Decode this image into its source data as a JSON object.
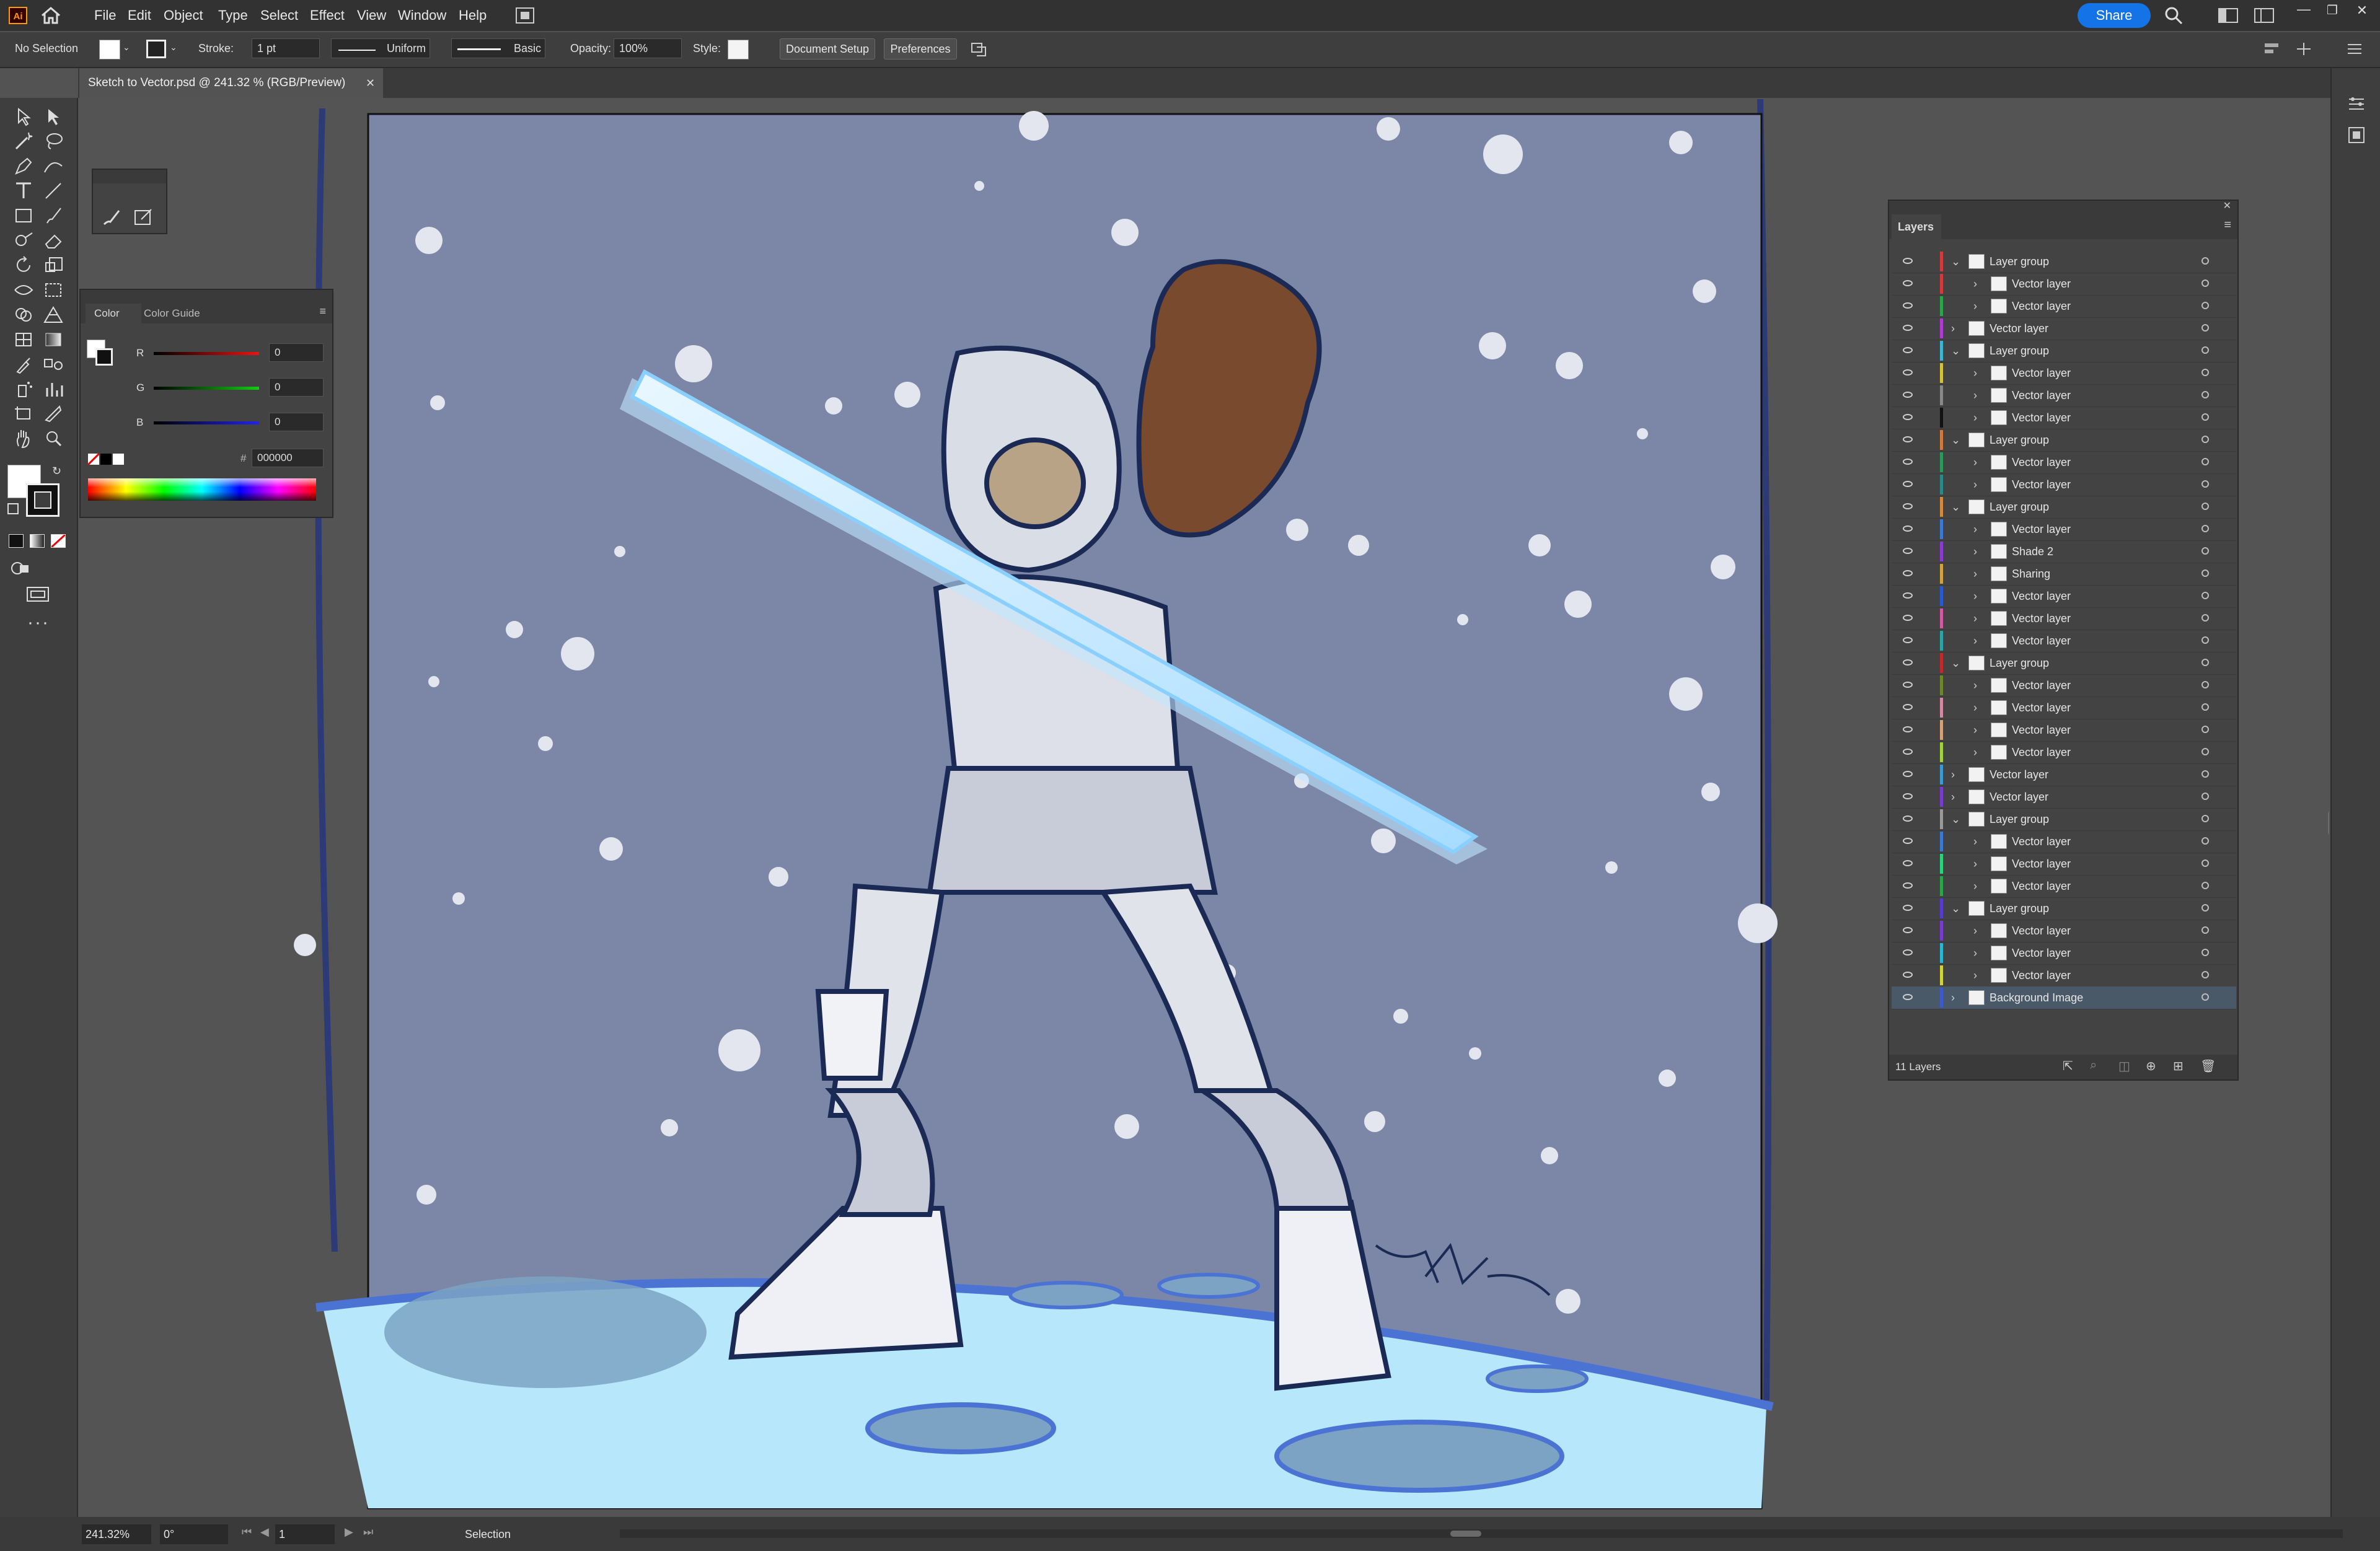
{
  "menubar": {
    "logo": "Ai",
    "items": [
      "File",
      "Edit",
      "Object",
      "Type",
      "Select",
      "Effect",
      "View",
      "Window",
      "Help"
    ],
    "share_label": "Share"
  },
  "controlbar": {
    "selection": "No Selection",
    "stroke_label": "Stroke:",
    "stroke_value": "1 pt",
    "profile": "Uniform",
    "brush": "Basic",
    "opacity_label": "Opacity:",
    "opacity_value": "100%",
    "style_label": "Style:",
    "doc_setup": "Document Setup",
    "preferences": "Preferences"
  },
  "document": {
    "tab_title": "Sketch to Vector.psd @ 241.32 % (RGB/Preview)"
  },
  "color_panel": {
    "tabs": [
      "Color",
      "Color Guide"
    ],
    "channels": [
      {
        "label": "R",
        "value": "0",
        "color": "#d22"
      },
      {
        "label": "G",
        "value": "0",
        "color": "#2a2"
      },
      {
        "label": "B",
        "value": "0",
        "color": "#22d"
      }
    ],
    "hex_label": "#",
    "hex_value": "000000"
  },
  "layers_panel": {
    "title": "Layers",
    "footer_count": "11 Layers",
    "rows": [
      {
        "name": "Layer group",
        "level": 0,
        "expanded": true,
        "color": "#d23b3b"
      },
      {
        "name": "Vector layer",
        "level": 1,
        "color": "#d23b3b"
      },
      {
        "name": "Vector layer",
        "level": 1,
        "color": "#2aa54a"
      },
      {
        "name": "Vector layer",
        "level": 0,
        "color": "#b03bd2"
      },
      {
        "name": "Layer group",
        "level": 0,
        "expanded": true,
        "color": "#3bb7d2"
      },
      {
        "name": "Vector layer",
        "level": 1,
        "color": "#d2c23b"
      },
      {
        "name": "Vector layer",
        "level": 1,
        "color": "#888888"
      },
      {
        "name": "Vector layer",
        "level": 1,
        "color": "#111111"
      },
      {
        "name": "Layer group",
        "level": 0,
        "expanded": true,
        "color": "#d27a3b"
      },
      {
        "name": "Vector layer",
        "level": 1,
        "color": "#2a9a5a"
      },
      {
        "name": "Vector layer",
        "level": 1,
        "color": "#2a8a8a"
      },
      {
        "name": "Layer group",
        "level": 0,
        "expanded": true,
        "color": "#d28a3b"
      },
      {
        "name": "Vector layer",
        "level": 1,
        "color": "#3b7ad2"
      },
      {
        "name": "Shade 2",
        "level": 1,
        "color": "#8a3bd2"
      },
      {
        "name": "Sharing",
        "level": 1,
        "color": "#d2a23b"
      },
      {
        "name": "Vector layer",
        "level": 1,
        "color": "#2a5ad2"
      },
      {
        "name": "Vector layer",
        "level": 1,
        "color": "#d25aa2"
      },
      {
        "name": "Vector layer",
        "level": 1,
        "color": "#2aa5a5"
      },
      {
        "name": "Layer group",
        "level": 0,
        "expanded": true,
        "color": "#c22a2a"
      },
      {
        "name": "Vector layer",
        "level": 1,
        "color": "#6a8a2a"
      },
      {
        "name": "Vector layer",
        "level": 1,
        "color": "#d28aa2"
      },
      {
        "name": "Vector layer",
        "level": 1,
        "color": "#d2a27a"
      },
      {
        "name": "Vector layer",
        "level": 1,
        "color": "#a2d23b"
      },
      {
        "name": "Vector layer",
        "level": 0,
        "color": "#3b9ad2"
      },
      {
        "name": "Vector layer",
        "level": 0,
        "color": "#7a3bd2"
      },
      {
        "name": "Layer group",
        "level": 0,
        "expanded": true,
        "color": "#9a9a9a"
      },
      {
        "name": "Vector layer",
        "level": 1,
        "color": "#3b7ad2"
      },
      {
        "name": "Vector layer",
        "level": 1,
        "color": "#2ad27a"
      },
      {
        "name": "Vector layer",
        "level": 1,
        "color": "#2aa54a"
      },
      {
        "name": "Layer group",
        "level": 0,
        "expanded": true,
        "color": "#5a3bd2"
      },
      {
        "name": "Vector layer",
        "level": 1,
        "color": "#7a3bd2"
      },
      {
        "name": "Vector layer",
        "level": 1,
        "color": "#2ab7d2"
      },
      {
        "name": "Vector layer",
        "level": 1,
        "color": "#d2d23b"
      },
      {
        "name": "Background Image",
        "level": 0,
        "selected": true,
        "color": "#3b5ad2"
      }
    ]
  },
  "statusbar": {
    "zoom": "241.32%",
    "rotation": "0°",
    "artboard": "1",
    "tool": "Selection"
  }
}
